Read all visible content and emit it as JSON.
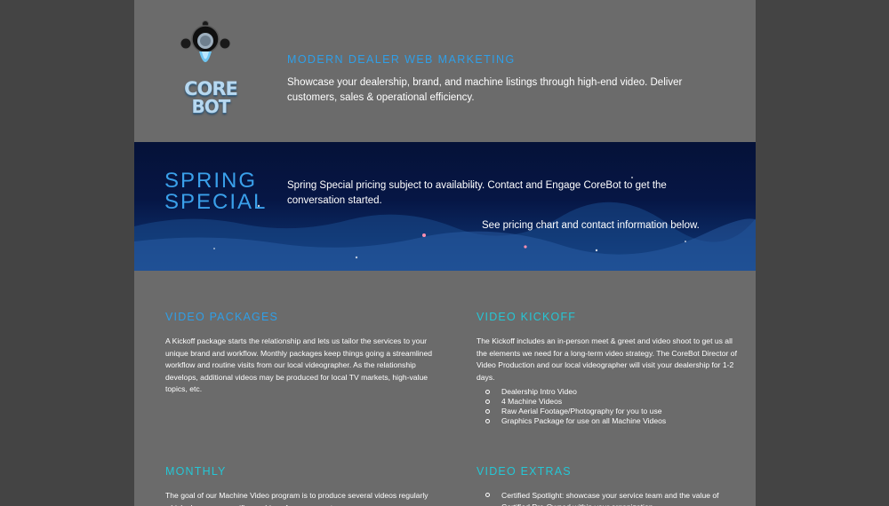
{
  "header": {
    "logo_line1": "CORE",
    "logo_line2": "BOT",
    "tagline": "MODERN DEALER WEB MARKETING",
    "intro": "Showcase your dealership, brand, and machine listings through high-end video. Deliver customers, sales & operational efficiency."
  },
  "banner": {
    "title": "SPRING SPECIAL",
    "text": "Spring Special pricing subject to availability. Contact and Engage CoreBot to get the conversation started.",
    "note": "See pricing chart and contact information below."
  },
  "sections": {
    "video_packages": {
      "title": "VIDEO PACKAGES",
      "body": "A Kickoff package starts the relationship and lets us tailor the services to your unique brand and workflow. Monthly packages keep things going a streamlined workflow and routine visits from our local videographer. As the relationship develops, additional videos may be produced for local TV markets, high-value topics, etc."
    },
    "video_kickoff": {
      "title": "VIDEO KICKOFF",
      "body": "The Kickoff includes an in-person meet & greet and video shoot to get us all the elements we need for a long-term video strategy. The CoreBot Director of Video Production and our local videographer will visit your dealership for 1-2 days.",
      "items": [
        "Dealership Intro Video",
        "4 Machine Videos",
        "Raw Aerial Footage/Photography for you to use",
        "Graphics Package for use on all Machine Videos"
      ]
    },
    "monthly": {
      "title": "MONTHLY",
      "body": "The goal of our Machine Video program is to produce several videos regularly which showcase specific machines from your roster."
    },
    "video_extras": {
      "title": "VIDEO EXTRAS",
      "items": [
        "Certified Spotlight: showcase your service team and the value of Certified Pre-Owned within your organization."
      ]
    }
  },
  "colors": {
    "accent_blue": "#2f9fe8",
    "accent_teal": "#24c7d6",
    "panel_gray": "#6b6b6b",
    "outer_gray": "#444444",
    "banner_navy": "#061645"
  },
  "icons": {
    "logo": "corebot-robot-logo"
  }
}
